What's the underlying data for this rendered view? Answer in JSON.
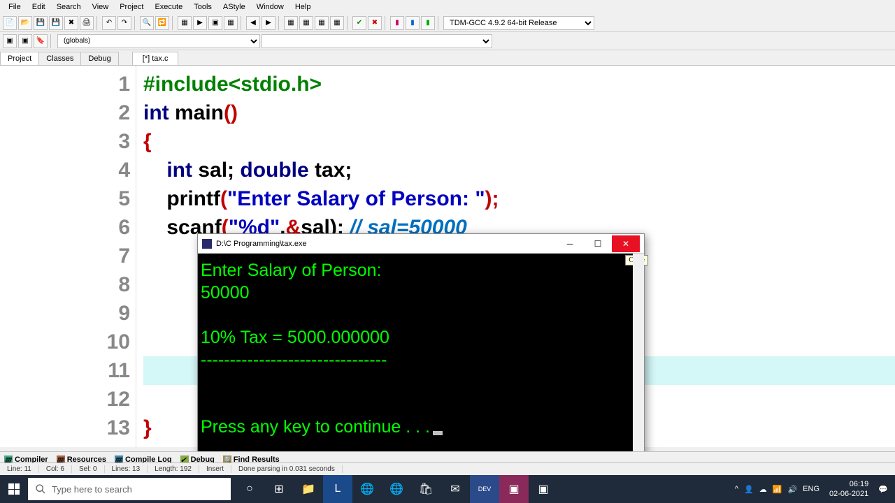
{
  "menu": [
    "File",
    "Edit",
    "Search",
    "View",
    "Project",
    "Execute",
    "Tools",
    "AStyle",
    "Window",
    "Help"
  ],
  "compiler_select": "TDM-GCC 4.9.2 64-bit Release",
  "globals": "(globals)",
  "side_tabs": [
    "Project",
    "Classes",
    "Debug"
  ],
  "file_tab": "[*] tax.c",
  "code": {
    "l1_include": "#include<stdio.h>",
    "l2_int": "int",
    "l2_main": " main",
    "l2_par": "()",
    "l3": "{",
    "l4_a": "    int",
    "l4_b": " sal; ",
    "l4_c": "double",
    "l4_d": " tax;",
    "l5_a": "    printf",
    "l5_b": "(",
    "l5_c": "\"Enter Salary of Person: \"",
    "l5_d": ");",
    "l6_a": "    scanf",
    "l6_b": "(",
    "l6_c": "\"%d\"",
    "l6_d": ",",
    "l6_e": "&",
    "l6_f": "sal);",
    "l6_g": " // sal=50000",
    "l13": "}"
  },
  "console": {
    "title": "D:\\C Programming\\tax.exe",
    "line1": "Enter Salary of Person:",
    "line2": "50000",
    "line3": "",
    "line4": "10% Tax = 5000.000000",
    "line5": "--------------------------------",
    "line6": "",
    "line7": "",
    "line8": "Press any key to continue . . .",
    "tooltip": "Close"
  },
  "bottom_tabs": [
    "Compiler",
    "Resources",
    "Compile Log",
    "Debug",
    "Find Results"
  ],
  "status": {
    "line": "Line:   11",
    "col": "Col:   6",
    "sel": "Sel:   0",
    "lines": "Lines:   13",
    "length": "Length:   192",
    "mode": "Insert",
    "msg": "Done parsing in 0.031 seconds"
  },
  "taskbar": {
    "search_placeholder": "Type here to search",
    "lang": "ENG",
    "time": "06:19",
    "date": "02-06-2021"
  }
}
